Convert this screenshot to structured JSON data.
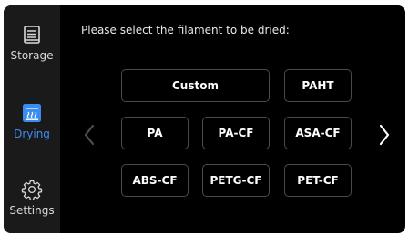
{
  "sidebar": {
    "items": [
      {
        "label": "Storage",
        "icon": "storage-icon",
        "active": false
      },
      {
        "label": "Drying",
        "icon": "drying-icon",
        "active": true
      },
      {
        "label": "Settings",
        "icon": "gear-icon",
        "active": false
      }
    ]
  },
  "main": {
    "prompt": "Please select the filament to be dried:",
    "filaments": [
      "Custom",
      "PAHT",
      "PA",
      "PA-CF",
      "ASA-CF",
      "ABS-CF",
      "PETG-CF",
      "PET-CF"
    ]
  },
  "colors": {
    "accent": "#3a8df0",
    "background": "#000000",
    "sidebar": "#1a1a1a",
    "button_border": "#4a4a4a"
  }
}
